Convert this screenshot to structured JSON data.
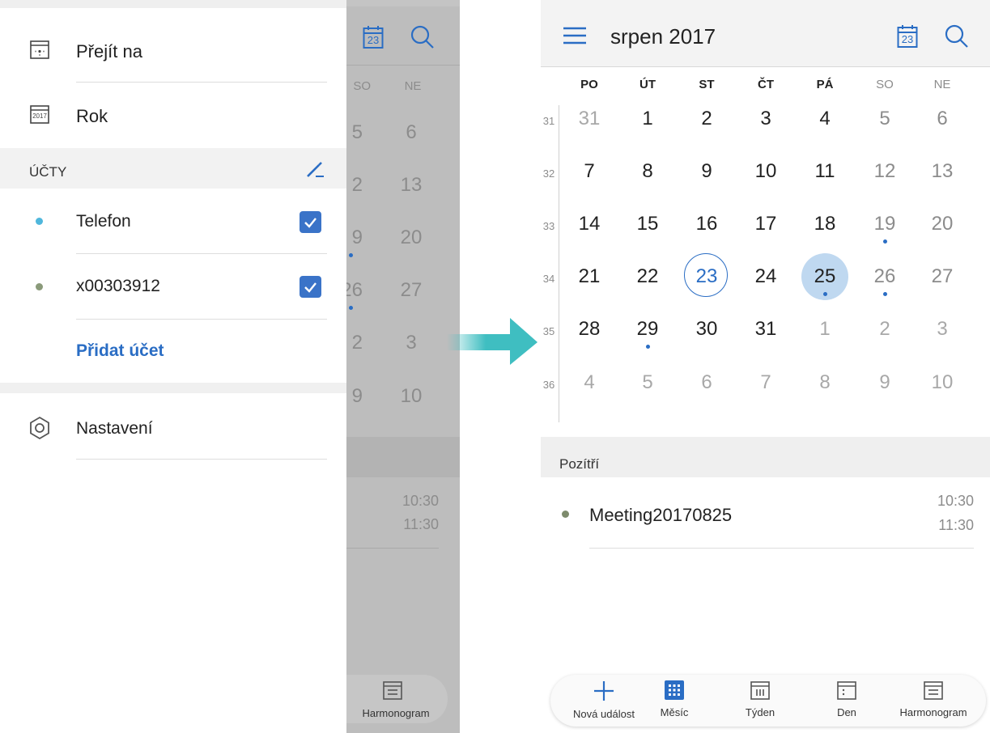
{
  "drawer": {
    "items": [
      {
        "label": "Přejít na",
        "icon": "calendar-goto-icon"
      },
      {
        "label": "Rok",
        "icon": "calendar-year-icon",
        "icon_text": "2017"
      }
    ],
    "accounts_header": "ÚČTY",
    "accounts": [
      {
        "label": "Telefon",
        "color": "#4fb7dc",
        "checked": true
      },
      {
        "label": "x00303912",
        "color": "#8a9a7a",
        "checked": true
      }
    ],
    "add_account": "Přidat účet",
    "settings": "Nastavení"
  },
  "underlay": {
    "calendar_icon_text": "23",
    "headers": [
      "SO",
      "NE"
    ],
    "rows": [
      [
        "5",
        "6"
      ],
      [
        "2",
        "13"
      ],
      [
        "9",
        "20"
      ],
      [
        "26",
        "27"
      ],
      [
        "2",
        "3"
      ],
      [
        "9",
        "10"
      ]
    ],
    "times": [
      "10:30",
      "11:30"
    ],
    "tab_label": "Harmonogram"
  },
  "header": {
    "title": "srpen 2017",
    "today_icon_text": "23"
  },
  "weekdays": [
    "PO",
    "ÚT",
    "ST",
    "ČT",
    "PÁ",
    "SO",
    "NE"
  ],
  "weeks": [
    {
      "week": "31",
      "days": [
        "31",
        "1",
        "2",
        "3",
        "4",
        "5",
        "6"
      ]
    },
    {
      "week": "32",
      "days": [
        "7",
        "8",
        "9",
        "10",
        "11",
        "12",
        "13"
      ]
    },
    {
      "week": "33",
      "days": [
        "14",
        "15",
        "16",
        "17",
        "18",
        "19",
        "20"
      ]
    },
    {
      "week": "34",
      "days": [
        "21",
        "22",
        "23",
        "24",
        "25",
        "26",
        "27"
      ]
    },
    {
      "week": "35",
      "days": [
        "28",
        "29",
        "30",
        "31",
        "1",
        "2",
        "3"
      ]
    },
    {
      "week": "36",
      "days": [
        "4",
        "5",
        "6",
        "7",
        "8",
        "9",
        "10"
      ]
    }
  ],
  "agenda": {
    "section_title": "Pozítří",
    "event": {
      "title": "Meeting20170825",
      "start": "10:30",
      "end": "11:30",
      "color": "#7d8b6c"
    }
  },
  "bottom_nav": [
    {
      "label": "Nová událost",
      "icon": "plus-icon"
    },
    {
      "label": "Měsíc",
      "icon": "month-grid-icon",
      "active": true
    },
    {
      "label": "Týden",
      "icon": "week-view-icon"
    },
    {
      "label": "Den",
      "icon": "day-view-icon"
    },
    {
      "label": "Harmonogram",
      "icon": "agenda-list-icon"
    }
  ],
  "colors": {
    "accent": "#2a6dc4",
    "arrow": "#3fbec1"
  }
}
